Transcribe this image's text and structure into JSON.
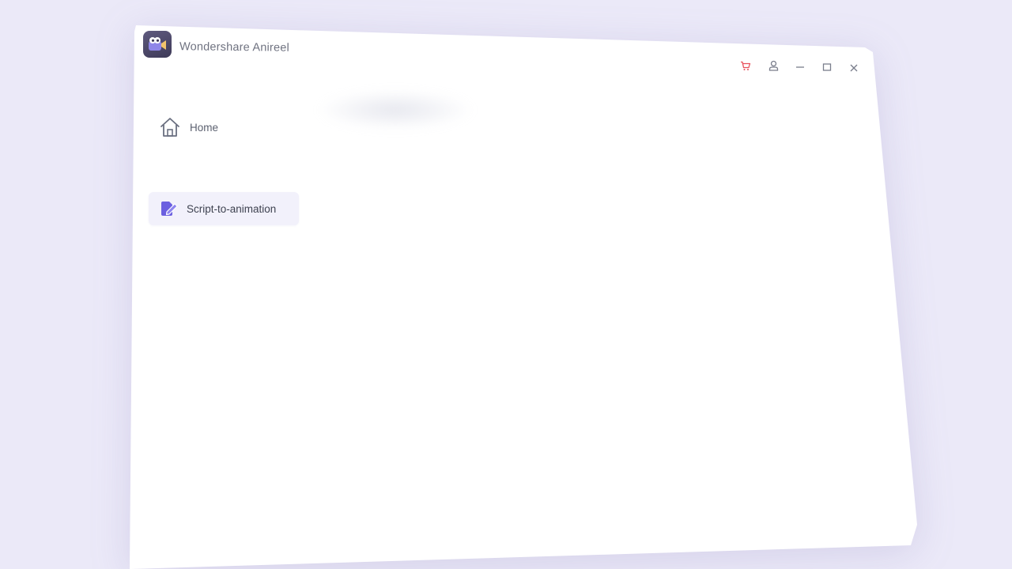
{
  "app": {
    "title": "Wondershare Anireel",
    "logo_icon": "anireel-logo-icon"
  },
  "title_bar": {
    "controls": [
      {
        "name": "cart-icon",
        "color": "#e8505b"
      },
      {
        "name": "user-icon",
        "color": "#7a7e8c"
      },
      {
        "name": "minimize-icon",
        "color": "#7a7e8c"
      },
      {
        "name": "maximize-icon",
        "color": "#7a7e8c"
      },
      {
        "name": "close-icon",
        "color": "#7a7e8c"
      }
    ]
  },
  "sidebar": {
    "items": [
      {
        "label": "Home",
        "icon": "home-icon",
        "active": false
      },
      {
        "label": "Script-to-animation",
        "icon": "script-edit-icon",
        "active": true
      }
    ]
  },
  "colors": {
    "background": "#ebe9f8",
    "window": "#ffffff",
    "accent": "#6b5fe0",
    "active_item_bg": "#f2f1fb"
  }
}
